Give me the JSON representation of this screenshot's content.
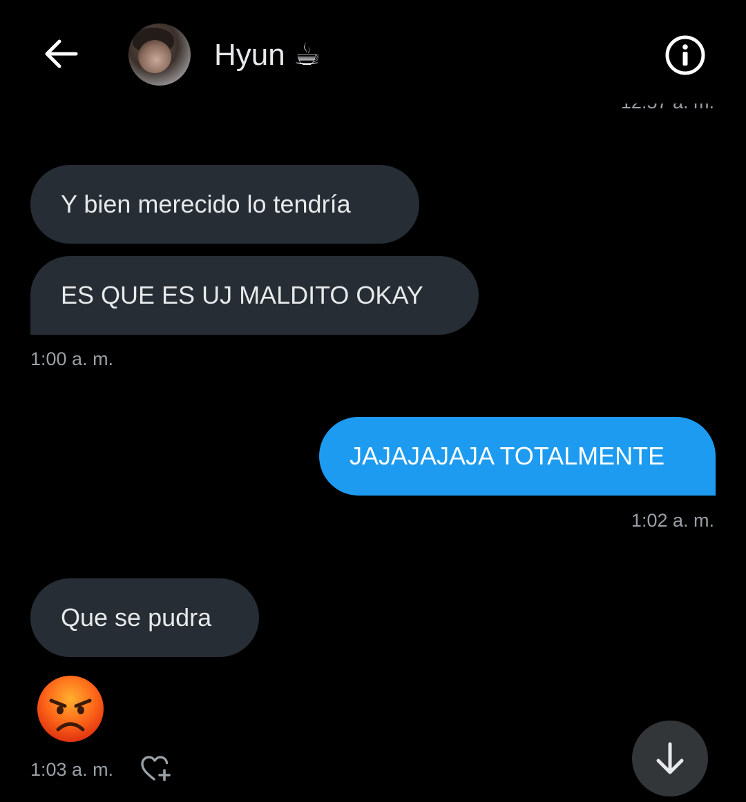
{
  "header": {
    "contact_name": "Hyun ☕",
    "back_icon": "arrow-left-icon",
    "info_icon": "info-circle-icon"
  },
  "messages": [
    {
      "direction": "in",
      "text": "Y bien merecido lo tendría"
    },
    {
      "direction": "in",
      "text": "ES QUE ES UJ MALDITO OKAY"
    },
    {
      "direction": "out",
      "text": "JAJAJAJAJA TOTALMENTE"
    },
    {
      "direction": "in",
      "text": "Que se pudra"
    },
    {
      "direction": "in",
      "text": "😡",
      "type": "emoji",
      "emoji_name": "angry-face"
    }
  ],
  "timestamps": {
    "top_clipped": "12:57 a. m.",
    "t1": "1:00 a. m.",
    "t2": "1:02 a. m.",
    "t3": "1:03 a. m."
  },
  "controls": {
    "react_icon": "heart-plus-icon",
    "scroll_down_icon": "arrow-down-icon"
  },
  "colors": {
    "background": "#000000",
    "incoming_bubble": "#262d34",
    "outgoing_bubble": "#1d9bf0",
    "timestamp_text": "#9aa0a6",
    "scroll_button": "#333639"
  }
}
